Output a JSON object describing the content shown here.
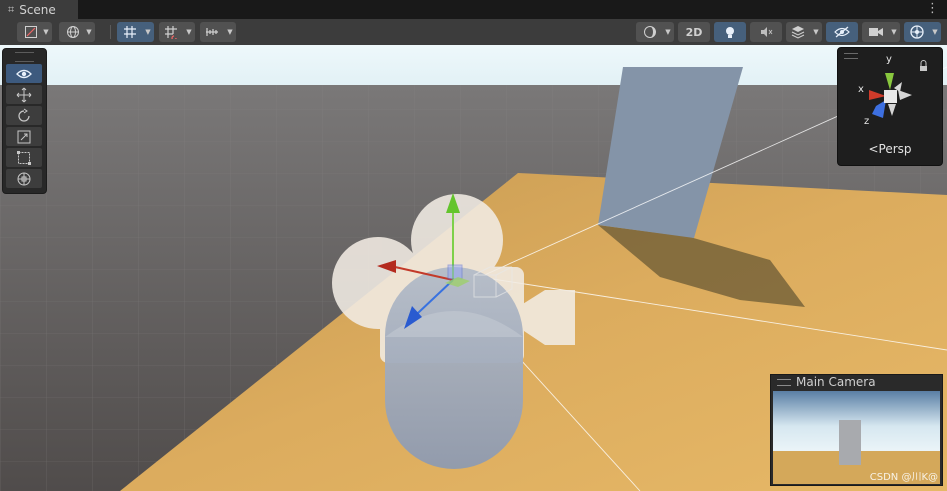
{
  "tabbar": {
    "tab_label": "Scene",
    "tab_icon": "grid-icon"
  },
  "toolbar": {
    "btn_2d": "2D",
    "icons": [
      "draw-mode-icon",
      "global-icon",
      "grid-snap-icon",
      "increment-snap-icon",
      "ruler-icon",
      "shading-icon",
      "lighting-icon",
      "audio-icon",
      "effects-icon",
      "visibility-icon",
      "camera-icon",
      "gizmos-icon"
    ]
  },
  "tools": [
    "view-tool",
    "move-tool",
    "rotate-tool",
    "scale-tool",
    "rect-tool",
    "transform-tool"
  ],
  "gizmo": {
    "y": "y",
    "x": "x",
    "z": "z",
    "projection": "Persp"
  },
  "camera_preview": {
    "title": "Main Camera"
  },
  "watermark": "CSDN @川K@",
  "colors": {
    "accent": "#46607c",
    "floor": "#d9a85a",
    "ground": "#5a5756",
    "sky": "#e4f4f8"
  }
}
